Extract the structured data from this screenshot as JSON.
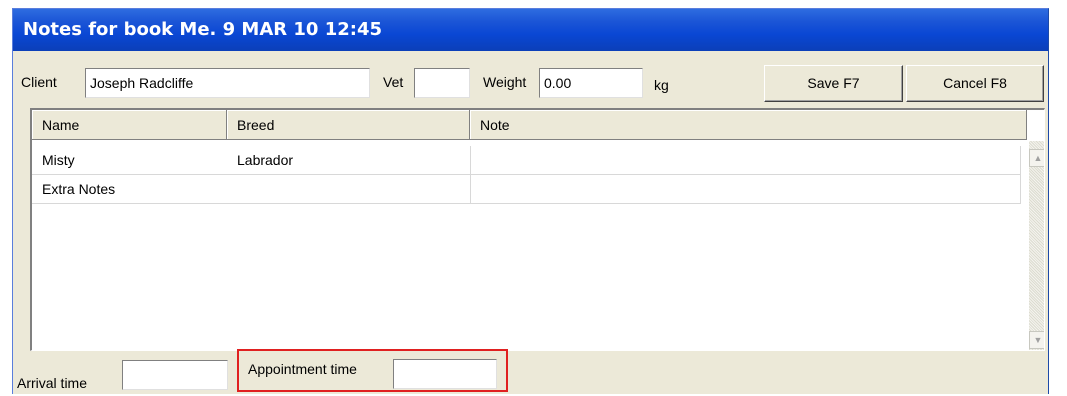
{
  "window": {
    "title": "Notes for book Me. 9 MAR 10 12:45"
  },
  "toolbar": {
    "client_label": "Client",
    "client_value": "Joseph Radcliffe",
    "vet_label": "Vet",
    "vet_value": "",
    "weight_label": "Weight",
    "weight_value": "0.00",
    "weight_unit": "kg",
    "save_label": "Save F7",
    "cancel_label": "Cancel F8"
  },
  "grid": {
    "columns": [
      "Name",
      "Breed",
      "Note"
    ],
    "rows": [
      {
        "name": "Misty",
        "breed": "Labrador",
        "note": ""
      },
      {
        "name": "Extra Notes",
        "breed": "",
        "note": ""
      }
    ]
  },
  "footer": {
    "arrival_label": "Arrival time",
    "arrival_value": "",
    "appointment_label": "Appointment time",
    "appointment_value": ""
  },
  "icons": {
    "scroll_up": "scroll-up-arrow-icon",
    "scroll_down": "scroll-down-arrow-icon"
  },
  "colors": {
    "title_bar": "#0a47d4",
    "highlight": "#e02020",
    "window_bg": "#ece9d8"
  }
}
